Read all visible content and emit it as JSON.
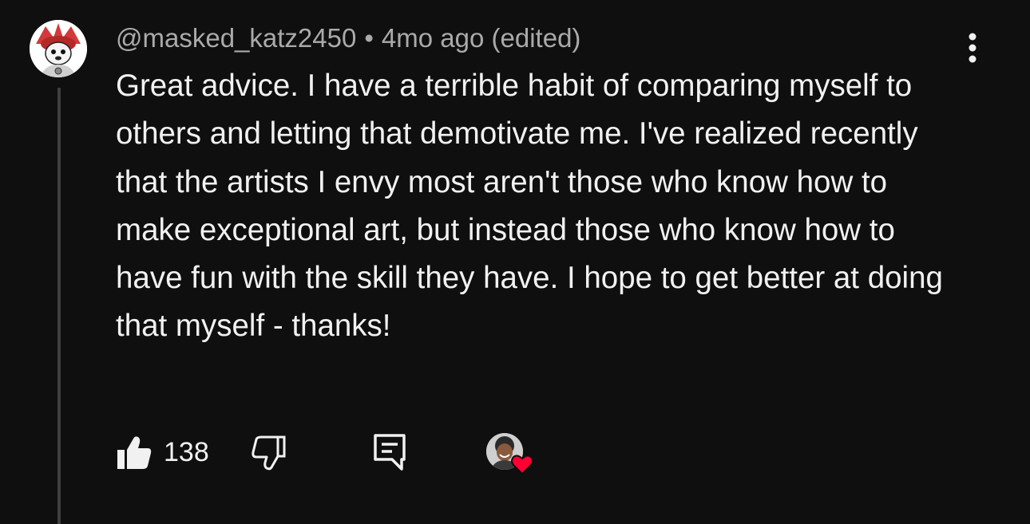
{
  "comment": {
    "author": "@masked_katz2450",
    "separator": "•",
    "timestamp": "4mo ago",
    "edited_label": "(edited)",
    "body": "Great advice. I have a terrible habit of comparing myself to others and letting that demotivate me. I've realized recently that the artists I envy most aren't those who know how to make exceptional art, but instead those who know how to have fun with the skill they have. I hope to get better at doing that myself - thanks!"
  },
  "actions": {
    "like_count": "138",
    "like_icon": "thumbs-up-filled-icon",
    "dislike_icon": "thumbs-down-outline-icon",
    "reply_icon": "reply-comment-icon",
    "creator_heart_icon": "heart-icon"
  },
  "menu": {
    "icon": "more-vertical-icon"
  },
  "colors": {
    "background": "#0f0f0f",
    "text_primary": "#f1f1f1",
    "text_secondary": "#aaaaaa",
    "thread_line": "#3f3f3f",
    "heart": "#ff0033"
  }
}
